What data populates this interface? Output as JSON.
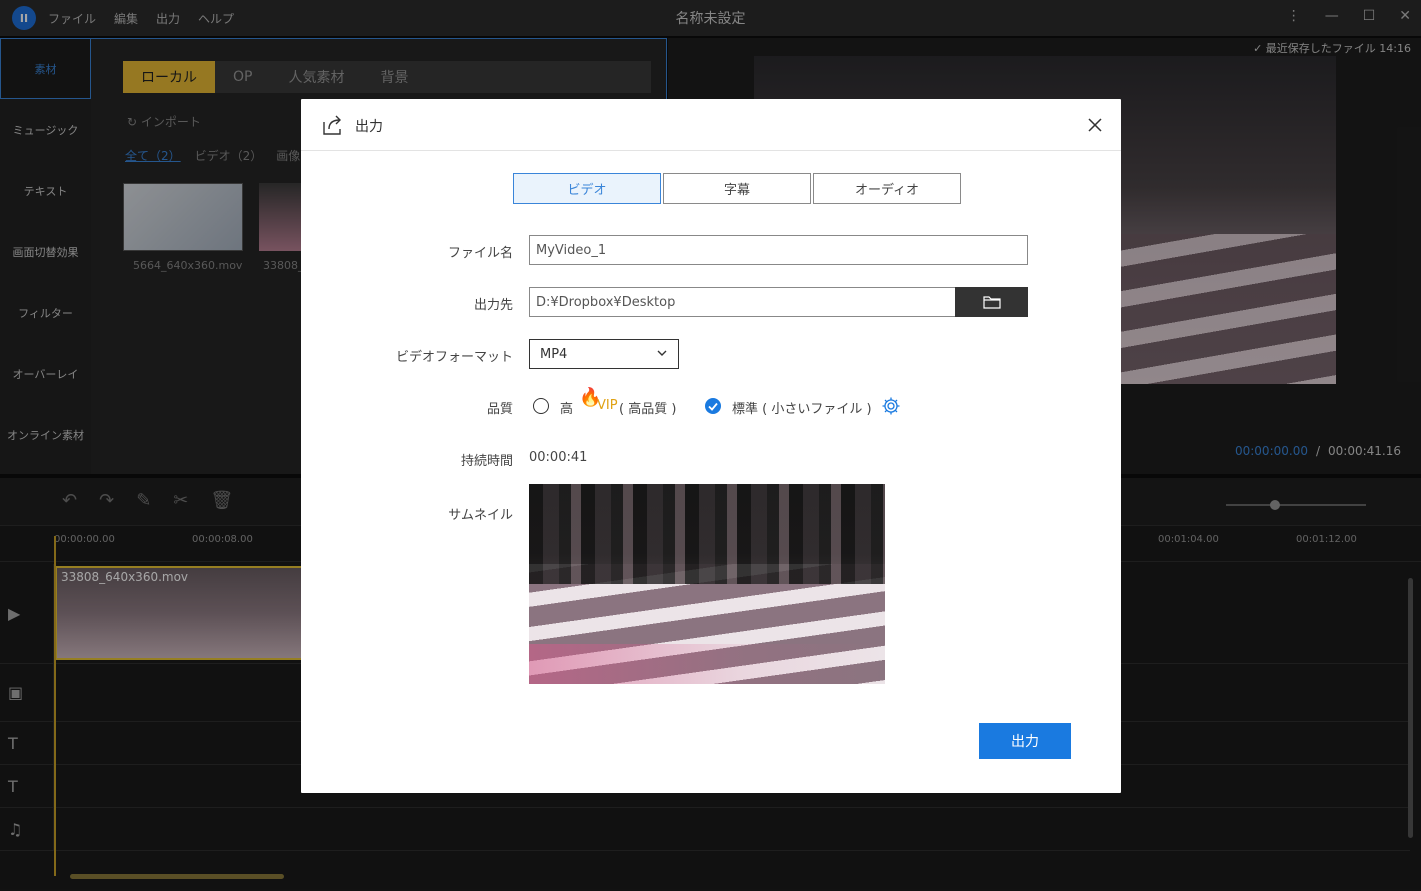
{
  "window": {
    "title": "名称未設定",
    "menu": [
      "ファイル",
      "編集",
      "出力",
      "ヘルプ"
    ],
    "logo_text": "II"
  },
  "sidebar": {
    "items": [
      {
        "label": "素材"
      },
      {
        "label": "ミュージック"
      },
      {
        "label": "テキスト"
      },
      {
        "label": "画面切替効果"
      },
      {
        "label": "フィルター"
      },
      {
        "label": "オーバーレイ"
      },
      {
        "label": "オンライン素材"
      }
    ]
  },
  "media": {
    "tabs": [
      "ローカル",
      "OP",
      "人気素材",
      "背景"
    ],
    "import_label": "インポート",
    "filters": [
      "全て（2）",
      "ビデオ（2）",
      "画像（"
    ],
    "files": [
      "5664_640x360.mov",
      "33808_"
    ]
  },
  "preview": {
    "saved_label": "最近保存したファイル 14:16",
    "time_current": "00:00:00.00",
    "time_separator": "/",
    "time_total": "00:00:41.16"
  },
  "timeline": {
    "ruler": [
      "00:00:00.00",
      "00:00:08.00",
      "00:01:04.00",
      "00:01:12.00"
    ],
    "clip_name": "33808_640x360.mov"
  },
  "dialog": {
    "title": "出力",
    "tabs": [
      "ビデオ",
      "字幕",
      "オーディオ"
    ],
    "labels": {
      "filename": "ファイル名",
      "destination": "出力先",
      "format": "ビデオフォーマット",
      "quality": "品質",
      "duration": "持続時間",
      "thumbnail": "サムネイル"
    },
    "filename_value": "MyVideo_1",
    "destination_value": "D:¥Dropbox¥Desktop",
    "format_value": "MP4",
    "quality": {
      "high_label": "高",
      "vip_label": "VIP",
      "high_suffix": "( 高品質 )",
      "standard_label": "標準 ( 小さいファイル )",
      "selected": "standard"
    },
    "duration_value": "00:00:41",
    "export_label": "出力"
  },
  "colors": {
    "accent": "#1a7ae0",
    "vip": "#e0a214",
    "tab_active": "#3a85d9"
  }
}
